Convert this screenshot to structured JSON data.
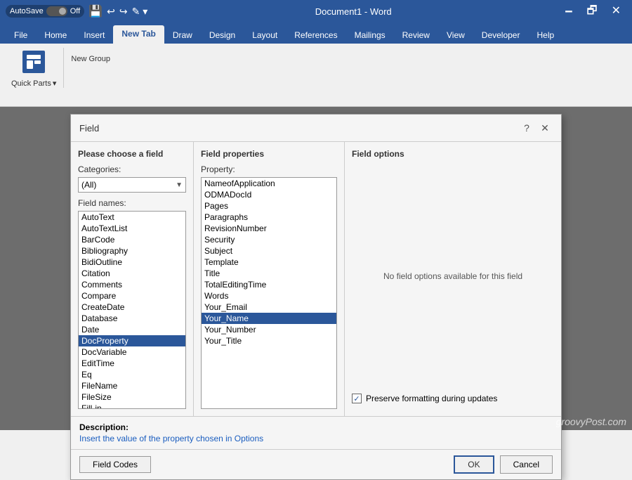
{
  "titlebar": {
    "autosave_label": "AutoSave",
    "toggle_state": "Off",
    "document_title": "Document1 - Word",
    "minimize": "🗕",
    "restore": "🗗",
    "close": "✕"
  },
  "ribbon": {
    "tabs": [
      "File",
      "Home",
      "Insert",
      "New Tab",
      "Draw",
      "Design",
      "Layout",
      "References",
      "Mailings",
      "Review",
      "View",
      "Developer",
      "Help"
    ],
    "active_tab": "New Tab",
    "group_label": "Quick Parts",
    "group_sublabel": "▾",
    "new_group": "New Group"
  },
  "dialog": {
    "title": "Field",
    "help_btn": "?",
    "close_btn": "✕",
    "left_panel": {
      "title": "Please choose a field",
      "categories_label": "Categories:",
      "categories_value": "(All)",
      "field_names_label": "Field names:",
      "field_names": [
        "AutoText",
        "AutoTextList",
        "BarCode",
        "Bibliography",
        "BidiOutline",
        "Citation",
        "Comments",
        "Compare",
        "CreateDate",
        "Database",
        "Date",
        "DocProperty",
        "DocVariable",
        "EditTime",
        "Eq",
        "FileName",
        "FileSize",
        "Fill-in"
      ],
      "selected_field": "DocProperty"
    },
    "middle_panel": {
      "title": "Field properties",
      "property_label": "Property:",
      "properties": [
        "NameofApplication",
        "ODMADocId",
        "Pages",
        "Paragraphs",
        "RevisionNumber",
        "Security",
        "Subject",
        "Template",
        "Title",
        "TotalEditingTime",
        "Words",
        "Your_Email",
        "Your_Name",
        "Your_Number",
        "Your_Title"
      ],
      "selected_property": "Your_Name"
    },
    "right_panel": {
      "title": "Field options",
      "no_options_msg": "No field options available for this field",
      "preserve_label": "Preserve formatting during updates",
      "preserve_checked": true
    },
    "description": {
      "label": "Description:",
      "text": "Insert the value of the property chosen in Options"
    },
    "footer": {
      "field_codes_btn": "Field Codes",
      "ok_btn": "OK",
      "cancel_btn": "Cancel"
    }
  },
  "watermark": "groovyPost.com"
}
